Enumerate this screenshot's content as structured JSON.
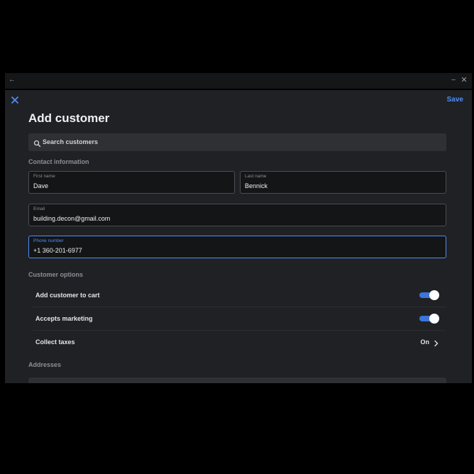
{
  "dialog": {
    "title": "Add customer",
    "save_label": "Save"
  },
  "search": {
    "placeholder": "Search customers"
  },
  "contact": {
    "section_label": "Contact information",
    "first_name": {
      "label": "First name",
      "value": "Dave"
    },
    "last_name": {
      "label": "Last name",
      "value": "Bennick"
    },
    "email": {
      "label": "Email",
      "value": "building.decon@gmail.com"
    },
    "phone": {
      "label": "Phone number",
      "value": "+1 360-201-6977"
    }
  },
  "options": {
    "section_label": "Customer options",
    "add_to_cart": {
      "label": "Add customer to cart",
      "enabled": true
    },
    "accepts_marketing": {
      "label": "Accepts marketing",
      "enabled": true
    },
    "collect_taxes": {
      "label": "Collect taxes",
      "value": "On"
    }
  },
  "addresses": {
    "section_label": "Addresses"
  },
  "colors": {
    "accent": "#4f8ef7",
    "toggle_on": "#3b76d8",
    "background": "#202124"
  },
  "icons": {
    "close": "close-icon",
    "search": "search-icon",
    "chevron": "chevron-right-icon",
    "back": "back-arrow-icon",
    "minimize": "minimize-icon",
    "window_close": "window-close-icon"
  }
}
